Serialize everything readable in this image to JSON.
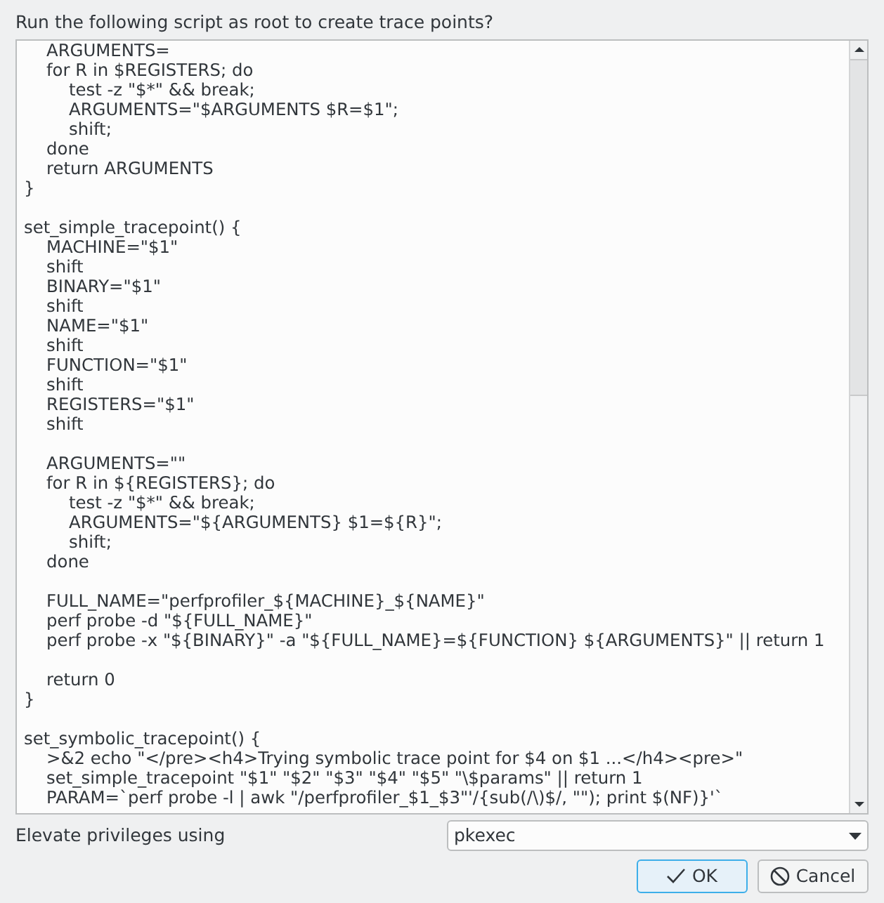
{
  "prompt": "Run the following script as root to create trace points?",
  "script": "\tARGUMENTS=\n\tfor R in $REGISTERS; do\n\t\ttest -z \"$*\" && break;\n\t\tARGUMENTS=\"$ARGUMENTS $R=$1\";\n\t\tshift;\n\tdone\n\treturn ARGUMENTS\n}\n\nset_simple_tracepoint() {\n\tMACHINE=\"$1\"\n\tshift\n\tBINARY=\"$1\"\n\tshift\n\tNAME=\"$1\"\n\tshift\n\tFUNCTION=\"$1\"\n\tshift\n\tREGISTERS=\"$1\"\n\tshift\n\n\tARGUMENTS=\"\"\n\tfor R in ${REGISTERS}; do\n\t\ttest -z \"$*\" && break;\n\t\tARGUMENTS=\"${ARGUMENTS} $1=${R}\";\n\t\tshift;\n\tdone\n\n\tFULL_NAME=\"perfprofiler_${MACHINE}_${NAME}\"\n\tperf probe -d \"${FULL_NAME}\"\n\tperf probe -x \"${BINARY}\" -a \"${FULL_NAME}=${FUNCTION} ${ARGUMENTS}\" || return 1\n\n\treturn 0\n}\n\nset_symbolic_tracepoint() {\n\t>&2 echo \"</pre><h4>Trying symbolic trace point for $4 on $1 ...</h4><pre>\"\n\tset_simple_tracepoint \"$1\" \"$2\" \"$3\" \"$4\" \"$5\" \"\\$params\" || return 1\n\tPARAM=`perf probe -l | awk \"/perfprofiler_$1_$3\"'/{sub(/\\)$/, \"\"); print $(NF)}'`",
  "elevate": {
    "label": "Elevate privileges using",
    "value": "pkexec"
  },
  "buttons": [
    {
      "label": "OK",
      "kind": "ok",
      "selected": true
    },
    {
      "label": "Cancel",
      "kind": "cancel",
      "selected": false
    }
  ]
}
